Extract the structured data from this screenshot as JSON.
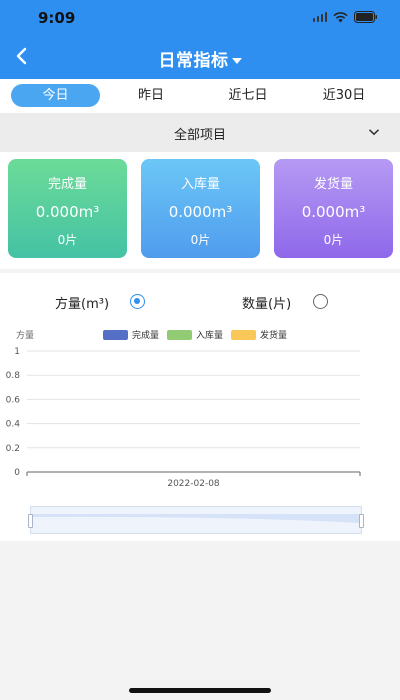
{
  "status_bar": {
    "time": "9:09"
  },
  "nav": {
    "title": "日常指标"
  },
  "tabs": [
    {
      "label": "今日",
      "active": true
    },
    {
      "label": "昨日",
      "active": false
    },
    {
      "label": "近七日",
      "active": false
    },
    {
      "label": "近30日",
      "active": false
    }
  ],
  "project_selector": {
    "value": "全部项目"
  },
  "cards": [
    {
      "title": "完成量",
      "volume": "0.000m³",
      "pieces": "0片"
    },
    {
      "title": "入库量",
      "volume": "0.000m³",
      "pieces": "0片"
    },
    {
      "title": "发货量",
      "volume": "0.000m³",
      "pieces": "0片"
    }
  ],
  "unit_toggle": [
    {
      "label": "方量(m³)",
      "selected": true
    },
    {
      "label": "数量(片)",
      "selected": false
    }
  ],
  "colors": {
    "nav_blue": "#2e8ff0",
    "series_completed": "#5470c6",
    "series_stocked": "#91cc75",
    "series_shipped": "#fac858"
  },
  "chart_data": {
    "type": "bar",
    "ylabel": "方量",
    "categories": [
      "2022-02-08"
    ],
    "series": [
      {
        "name": "完成量",
        "values": [
          0
        ]
      },
      {
        "name": "入库量",
        "values": [
          0
        ]
      },
      {
        "name": "发货量",
        "values": [
          0
        ]
      }
    ],
    "ylim": [
      0,
      1
    ],
    "y_ticks": [
      "1",
      "0.8",
      "0.6",
      "0.4",
      "0.2",
      "0"
    ],
    "grid": true,
    "legend": "top-center",
    "zoom_slider": true
  }
}
